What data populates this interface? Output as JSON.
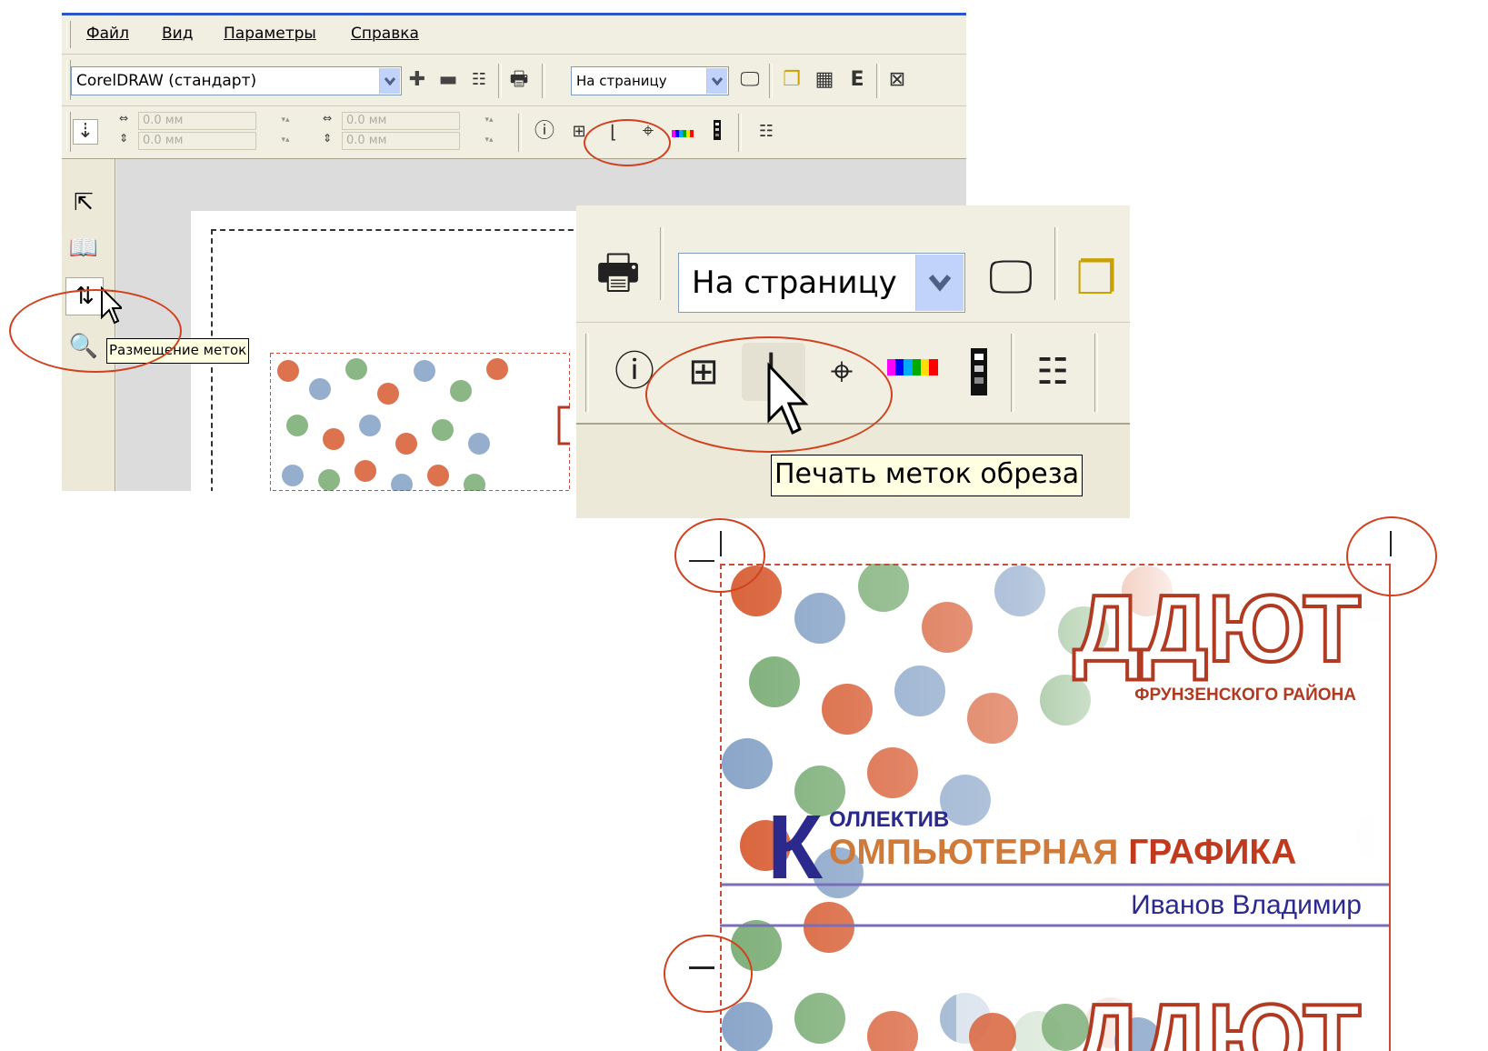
{
  "menu": {
    "items": [
      "Файл",
      "Вид",
      "Параметры",
      "Справка"
    ]
  },
  "toolbar1": {
    "preset_value": "CorelDRAW (стандарт)",
    "fit_value": "На страницу"
  },
  "toolbar2": {
    "x_value": "0.0 мм",
    "y_value": "0.0 мм",
    "w_value": "0.0 мм",
    "h_value": "0.0 мм"
  },
  "toolbox": {
    "tooltip": "Размещение меток"
  },
  "zoom": {
    "fit_value": "На страницу",
    "tooltip": "Печать меток обреза"
  },
  "card": {
    "title": "ДДЮТ",
    "subtitle": "ФРУНЗЕНСКОГО РАЙОНА",
    "collective_initial": "К",
    "collective_word": "ОЛЛЕКТИВ",
    "computer_word": "ОМПЬЮТЕРНАЯ",
    "graphics_word": "ГРАФИКА",
    "person": "Иванов Владимир"
  },
  "colors": {
    "highlight_circle": "#d0421f",
    "title_outline": "#b03a22",
    "collective_text": "#2b2a8c",
    "graphics_text": "#c23a1e",
    "xp_blue_bar": "#2a55c8",
    "tooltip_bg": "#ffffe1"
  }
}
